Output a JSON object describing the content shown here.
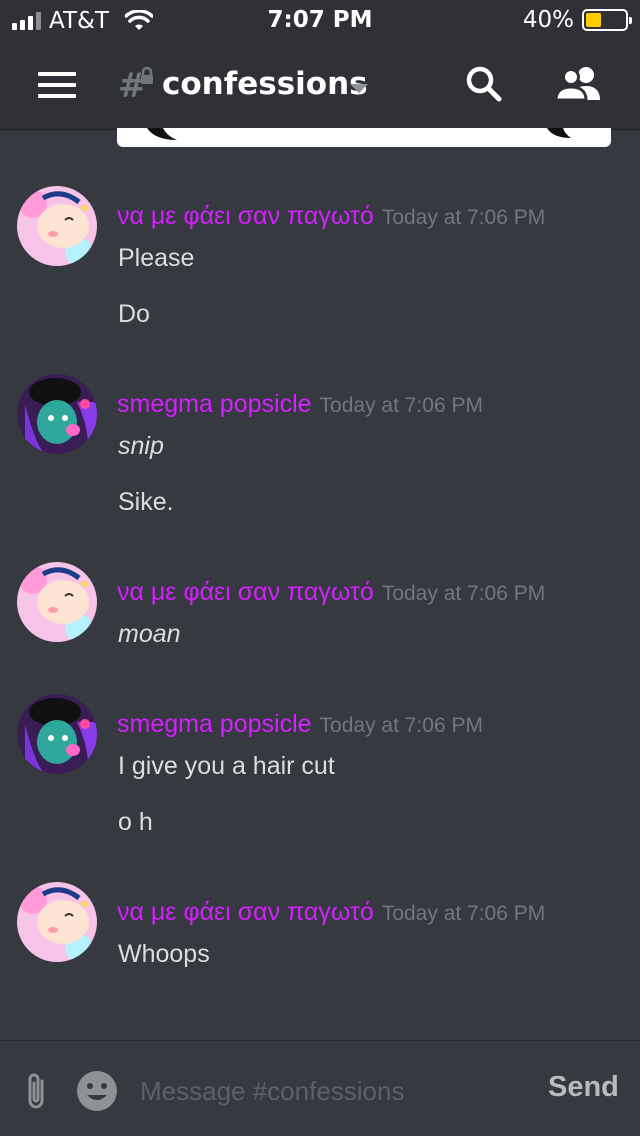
{
  "status_bar": {
    "carrier": "AT&T",
    "time": "7:07 PM",
    "battery_percent": "40%",
    "battery_level": 0.4,
    "battery_color": "#ffcc00"
  },
  "header": {
    "menu_icon": "hamburger-menu-icon",
    "channel_hash": "#",
    "channel_name": "confessions",
    "search_icon": "search-icon",
    "members_icon": "members-icon"
  },
  "colors": {
    "background": "#36393f",
    "header_bg": "#2f3136",
    "author_color": "#d41fff",
    "timestamp_color": "#72767d",
    "text_color": "#dcddde"
  },
  "messages": [
    {
      "author": "να με φάει σαν παγωτό",
      "timestamp": "Today at 7:06 PM",
      "avatar": "pink-character-avatar",
      "lines": [
        "Please",
        "Do"
      ]
    },
    {
      "author": "smegma popsicle",
      "timestamp": "Today at 7:06 PM",
      "avatar": "purple-character-avatar",
      "lines": [
        "snip",
        "Sike."
      ]
    },
    {
      "author": "να με φάει σαν παγωτό",
      "timestamp": "Today at 7:06 PM",
      "avatar": "pink-character-avatar",
      "lines": [
        "moan"
      ]
    },
    {
      "author": "smegma popsicle",
      "timestamp": "Today at 7:06 PM",
      "avatar": "purple-character-avatar",
      "lines": [
        "I give you a hair cut",
        "o h"
      ]
    },
    {
      "author": "να με φάει σαν παγωτό",
      "timestamp": "Today at 7:06 PM",
      "avatar": "pink-character-avatar",
      "lines": [
        "Whoops"
      ]
    }
  ],
  "composer": {
    "placeholder": "Message #confessions",
    "send_label": "Send",
    "attach_icon": "paperclip-icon",
    "emoji_icon": "emoji-icon"
  }
}
